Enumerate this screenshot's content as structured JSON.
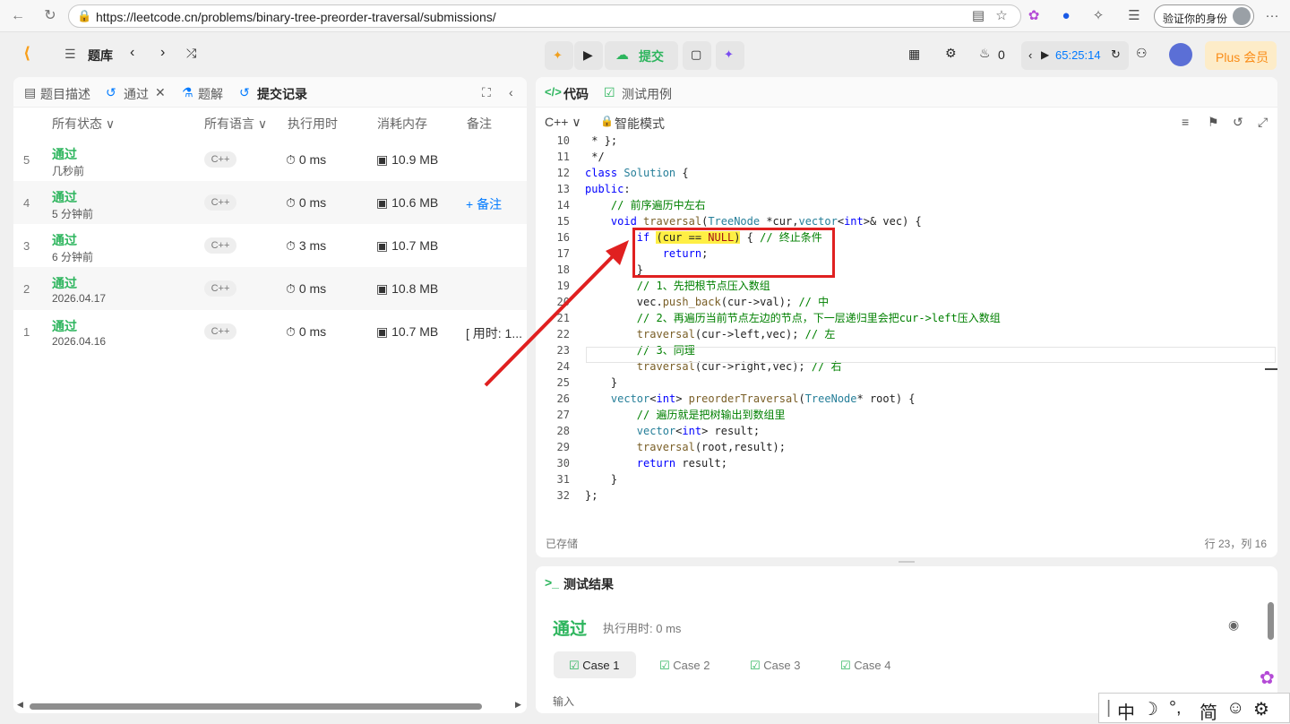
{
  "browser": {
    "url": "https://leetcode.cn/problems/binary-tree-preorder-traversal/submissions/",
    "verify_label": "验证你的身份",
    "more_label": "···"
  },
  "header": {
    "problem_list_label": "题库",
    "submit_label": "提交",
    "streak_count": "0",
    "timer": "65:25:14",
    "plus_label": "Plus 会员"
  },
  "left_tabs": {
    "description": "题目描述",
    "passed": "通过",
    "solutions": "题解",
    "submissions": "提交记录"
  },
  "submission_columns": {
    "status": "所有状态",
    "language": "所有语言",
    "runtime": "执行用时",
    "memory": "消耗内存",
    "notes": "备注"
  },
  "submissions": [
    {
      "num": "5",
      "status": "通过",
      "time_ago": "几秒前",
      "lang": "C++",
      "runtime": "0 ms",
      "memory": "10.9 MB",
      "note": ""
    },
    {
      "num": "4",
      "status": "通过",
      "time_ago": "5 分钟前",
      "lang": "C++",
      "runtime": "0 ms",
      "memory": "10.6 MB",
      "note": "+ 备注"
    },
    {
      "num": "3",
      "status": "通过",
      "time_ago": "6 分钟前",
      "lang": "C++",
      "runtime": "3 ms",
      "memory": "10.7 MB",
      "note": ""
    },
    {
      "num": "2",
      "status": "通过",
      "time_ago": "2026.04.17",
      "lang": "C++",
      "runtime": "0 ms",
      "memory": "10.8 MB",
      "note": ""
    },
    {
      "num": "1",
      "status": "通过",
      "time_ago": "2026.04.16",
      "lang": "C++",
      "runtime": "0 ms",
      "memory": "10.7 MB",
      "note": "[ 用时: 1..."
    }
  ],
  "code_tabs": {
    "code": "代码",
    "testcase": "测试用例"
  },
  "code_toolbar": {
    "language": "C++",
    "mode": "智能模式"
  },
  "code_lines": [
    {
      "n": "10",
      "t": " * };"
    },
    {
      "n": "11",
      "t": " */"
    },
    {
      "n": "12",
      "t": "class Solution {"
    },
    {
      "n": "13",
      "t": "public:"
    },
    {
      "n": "14",
      "t": "    // 前序遍历中左右"
    },
    {
      "n": "15",
      "t": "    void traversal(TreeNode *cur,vector<int>& vec) {"
    },
    {
      "n": "16",
      "t": "        if (cur == NULL) { // 终止条件"
    },
    {
      "n": "17",
      "t": "            return;"
    },
    {
      "n": "18",
      "t": "        }"
    },
    {
      "n": "19",
      "t": "        // 1、先把根节点压入数组"
    },
    {
      "n": "20",
      "t": "        vec.push_back(cur->val); // 中"
    },
    {
      "n": "21",
      "t": "        // 2、再遍历当前节点左边的节点，下一层递归里会把cur->left压入数组"
    },
    {
      "n": "22",
      "t": "        traversal(cur->left,vec); // 左"
    },
    {
      "n": "23",
      "t": "        // 3、同理"
    },
    {
      "n": "24",
      "t": "        traversal(cur->right,vec); // 右"
    },
    {
      "n": "25",
      "t": "    }"
    },
    {
      "n": "26",
      "t": "    vector<int> preorderTraversal(TreeNode* root) {"
    },
    {
      "n": "27",
      "t": "        // 遍历就是把树输出到数组里"
    },
    {
      "n": "28",
      "t": "        vector<int> result;"
    },
    {
      "n": "29",
      "t": "        traversal(root,result);"
    },
    {
      "n": "30",
      "t": "        return result;"
    },
    {
      "n": "31",
      "t": "    }"
    },
    {
      "n": "32",
      "t": "};"
    }
  ],
  "code_footer": {
    "saved": "已存储",
    "cursor_pos": "行 23，列 16"
  },
  "result": {
    "title": "测试结果",
    "status": "通过",
    "runtime": "执行用时: 0 ms",
    "cases": [
      "Case 1",
      "Case 2",
      "Case 3",
      "Case 4"
    ],
    "input_label": "输入"
  },
  "ime": {
    "chars": [
      "中",
      "简"
    ]
  },
  "colors": {
    "accept_green": "#2db55d",
    "link_blue": "#007aff",
    "annotation_red": "#e02020",
    "highlight_yellow": "#ffef44"
  }
}
